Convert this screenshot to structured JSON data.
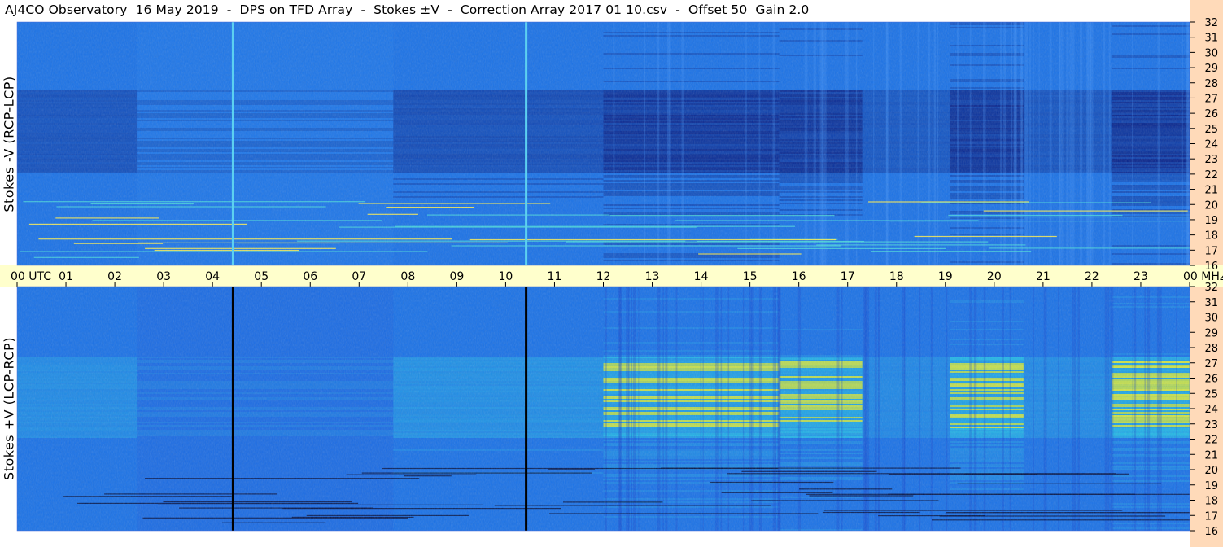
{
  "header": {
    "title": "AJ4CO Observatory  16 May 2019  -  DPS on TFD Array  -  Stokes ±V  -  Correction Array 2017 01 10.csv  -  Offset 50  Gain 2.0"
  },
  "chart_data": [
    {
      "type": "heatmap",
      "panel": "top",
      "ylabel": "Stokes -V (RCP-LCP)",
      "y_ticks": [
        "32",
        "31",
        "30",
        "29",
        "28",
        "27",
        "26",
        "25",
        "24",
        "23",
        "22",
        "21",
        "20",
        "19",
        "18",
        "17",
        "16"
      ],
      "x_ticks": [
        "00",
        "01",
        "02",
        "03",
        "04",
        "05",
        "06",
        "07",
        "08",
        "09",
        "10",
        "11",
        "12",
        "13",
        "14",
        "15",
        "16",
        "17",
        "18",
        "19",
        "20",
        "21",
        "22",
        "23",
        "00"
      ],
      "y_unit": "MHz",
      "x_unit": "UTC",
      "ylim": [
        16,
        32
      ],
      "xlim_hours": [
        0,
        24
      ],
      "vertical_lines_hours": [
        4.42,
        10.42
      ]
    },
    {
      "type": "heatmap",
      "panel": "bottom",
      "ylabel": "Stokes +V (LCP-RCP)",
      "y_ticks": [
        "32",
        "31",
        "30",
        "29",
        "28",
        "27",
        "26",
        "25",
        "24",
        "23",
        "22",
        "21",
        "20",
        "19",
        "18",
        "17",
        "16"
      ],
      "x_ticks": [
        "00",
        "01",
        "02",
        "03",
        "04",
        "05",
        "06",
        "07",
        "08",
        "09",
        "10",
        "11",
        "12",
        "13",
        "14",
        "15",
        "16",
        "17",
        "18",
        "19",
        "20",
        "21",
        "22",
        "23",
        "00"
      ],
      "y_unit": "MHz",
      "x_unit": "UTC",
      "ylim": [
        16,
        32
      ],
      "xlim_hours": [
        0,
        24
      ],
      "vertical_lines_hours": [
        4.42,
        10.42
      ]
    }
  ],
  "time_axis": {
    "labels": [
      "00",
      "01",
      "02",
      "03",
      "04",
      "05",
      "06",
      "07",
      "08",
      "09",
      "10",
      "11",
      "12",
      "13",
      "14",
      "15",
      "16",
      "17",
      "18",
      "19",
      "20",
      "21",
      "22",
      "23",
      "00"
    ],
    "first_suffix": "UTC",
    "last_suffix": "MHz"
  },
  "colors": {
    "band_bg": "#ffffcc",
    "right_axis_bg": "#ffdab9",
    "waterfall_base": "#1a6fe0",
    "waterfall_dark": "#0a2f9a",
    "waterfall_bright": "#ffff40"
  }
}
